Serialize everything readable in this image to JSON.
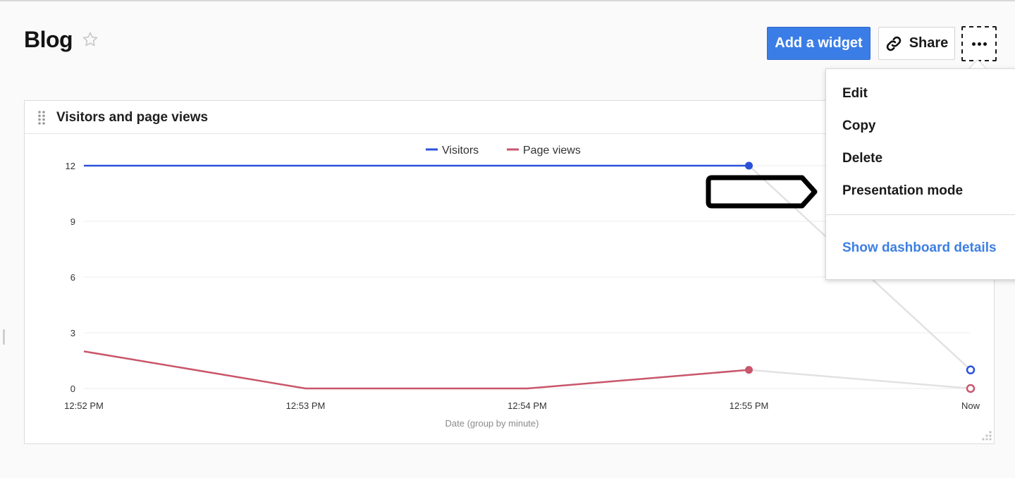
{
  "header": {
    "title": "Blog",
    "favorite_icon": "star-outline-icon",
    "add_widget_label": "Add a widget",
    "share_label": "Share",
    "share_icon": "link-icon",
    "more_icon": "ellipsis-icon"
  },
  "widget": {
    "title": "Visitors and page views",
    "drag_icon": "drag-handle-icon",
    "resize_icon": "resize-corner-icon"
  },
  "menu": {
    "items": [
      {
        "label": "Edit"
      },
      {
        "label": "Copy"
      },
      {
        "label": "Delete"
      },
      {
        "label": "Presentation mode"
      }
    ],
    "link_label": "Show dashboard details"
  },
  "colors": {
    "accent": "#3b7de6",
    "visitors": "#2a52d9",
    "page_views": "#c9566b",
    "link": "#3d7fe3"
  },
  "chart_data": {
    "type": "line",
    "title": "Visitors and page views",
    "xlabel": "Date (group by minute)",
    "ylabel": "",
    "categories": [
      "12:52 PM",
      "12:53 PM",
      "12:54 PM",
      "12:55 PM",
      "Now"
    ],
    "ylim": [
      0,
      12
    ],
    "yticks": [
      0,
      3,
      6,
      9,
      12
    ],
    "grid": true,
    "legend": "top-center",
    "series": [
      {
        "name": "Visitors",
        "color": "#2a52d9",
        "values": [
          12,
          12,
          12,
          12,
          1
        ],
        "last_point_incomplete": true
      },
      {
        "name": "Page views",
        "color": "#c9566b",
        "values": [
          2,
          0,
          0,
          1,
          0
        ],
        "last_point_incomplete": true
      }
    ]
  }
}
